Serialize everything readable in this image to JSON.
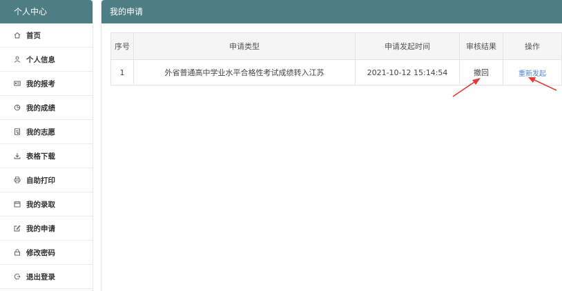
{
  "sidebar": {
    "title": "个人中心",
    "items": [
      {
        "label": "首页",
        "icon": "home-icon"
      },
      {
        "label": "个人信息",
        "icon": "user-icon"
      },
      {
        "label": "我的报考",
        "icon": "id-card-icon"
      },
      {
        "label": "我的成绩",
        "icon": "pie-chart-icon"
      },
      {
        "label": "我的志愿",
        "icon": "form-icon"
      },
      {
        "label": "表格下载",
        "icon": "download-icon"
      },
      {
        "label": "自助打印",
        "icon": "printer-icon"
      },
      {
        "label": "我的录取",
        "icon": "calendar-icon"
      },
      {
        "label": "我的申请",
        "icon": "edit-icon"
      },
      {
        "label": "修改密码",
        "icon": "lock-icon"
      },
      {
        "label": "退出登录",
        "icon": "logout-icon"
      }
    ]
  },
  "main": {
    "title": "我的申请",
    "table": {
      "headers": [
        "序号",
        "申请类型",
        "申请发起时间",
        "审核结果",
        "操作"
      ],
      "rows": [
        {
          "index": "1",
          "type": "外省普通高中学业水平合格性考试成绩转入江苏",
          "time": "2021-10-12 15:14:54",
          "result": "撤回",
          "action": "重新发起"
        }
      ]
    }
  },
  "colors": {
    "header_bg": "#4d7d85",
    "link": "#4a86d8",
    "annotation": "#e53935"
  }
}
